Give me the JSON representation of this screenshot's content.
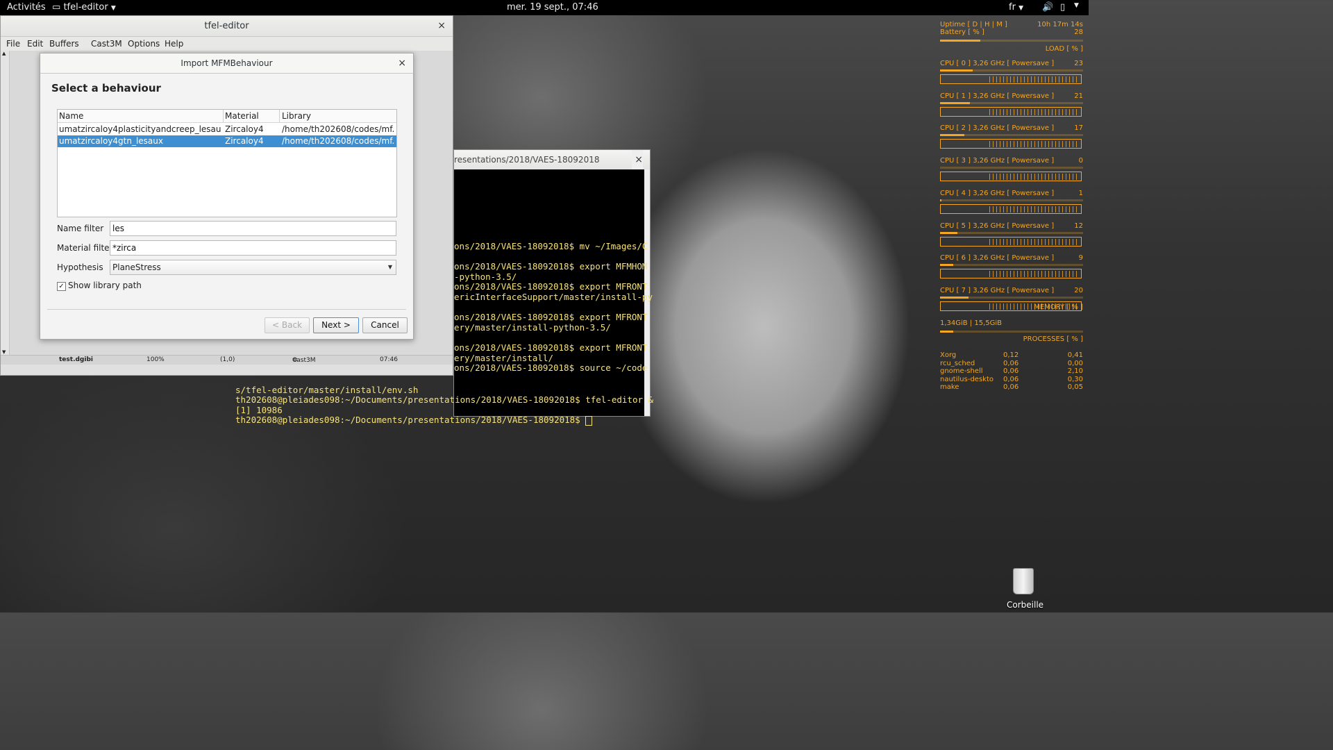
{
  "topbar": {
    "activities": "Activités",
    "app_menu": "tfel-editor",
    "clock": "mer. 19 sept., 07:46",
    "language": "fr"
  },
  "main_window": {
    "title": "tfel-editor",
    "menu": [
      "File",
      "Edit",
      "Buffers",
      "Cast3M",
      "Options",
      "Help"
    ],
    "status": {
      "file": "test.dgibi",
      "zoom": "100%",
      "position": "(1,0)",
      "mode": "Cast3M",
      "time": "07:46"
    }
  },
  "dialog": {
    "title": "Import MFMBehaviour",
    "heading": "Select a behaviour",
    "columns": [
      "Name",
      "Material",
      "Library"
    ],
    "rows": [
      {
        "name": "umatzircaloy4plasticityandcreep_lesaux",
        "material": "Zircaloy4",
        "library": "/home/th202608/codes/mf...",
        "selected": false
      },
      {
        "name": "umatzircaloy4gtn_lesaux",
        "material": "Zircaloy4",
        "library": "/home/th202608/codes/mf...",
        "selected": true
      }
    ],
    "name_filter_label": "Name filter",
    "name_filter_value": "les",
    "material_filter_label": "Material filter",
    "material_filter_value": "*zirca",
    "hypothesis_label": "Hypothesis",
    "hypothesis_value": "PlaneStress",
    "show_library_label": "Show library path",
    "show_library_checked": true,
    "buttons": {
      "back": "< Back",
      "next": "Next >",
      "cancel": "Cancel"
    }
  },
  "terminal": {
    "title": "resentations/2018/VAES-18092018",
    "lines_inner": [
      "ons/2018/VAES-18092018$ mv ~/Images/C",
      "",
      "ons/2018/VAES-18092018$ export MFMHOM",
      "-python-3.5/",
      "ons/2018/VAES-18092018$ export MFRONT",
      "ericInterfaceSupport/master/install-py",
      "",
      "ons/2018/VAES-18092018$ export MFRONT",
      "ery/master/install-python-3.5/",
      "",
      "ons/2018/VAES-18092018$ export MFRONT",
      "ery/master/install/",
      "ons/2018/VAES-18092018$ source ~/code"
    ],
    "lines_outer": [
      "s/tfel-editor/master/install/env.sh",
      "th202608@pleiades098:~/Documents/presentations/2018/VAES-18092018$ tfel-editor &",
      "[1] 10986",
      "th202608@pleiades098:~/Documents/presentations/2018/VAES-18092018$ "
    ]
  },
  "conky": {
    "uptime_label": "Uptime [ D | H | M ]",
    "uptime_value": "10h 17m 14s",
    "battery_label": "Battery [ % ]",
    "battery_value": "28",
    "battery_fraction": 0.28,
    "load_label": "LOAD [ % ]",
    "cpus": [
      {
        "label": "CPU [ 0 ] 3,26 GHz [ Powersave ]",
        "value": "23",
        "fraction": 0.23
      },
      {
        "label": "CPU [ 1 ] 3,26 GHz [ Powersave ]",
        "value": "21",
        "fraction": 0.21
      },
      {
        "label": "CPU [ 2 ] 3,26 GHz [ Powersave ]",
        "value": "17",
        "fraction": 0.17
      },
      {
        "label": "CPU [ 3 ] 3,26 GHz [ Powersave ]",
        "value": "0",
        "fraction": 0.0
      },
      {
        "label": "CPU [ 4 ] 3,26 GHz [ Powersave ]",
        "value": "1",
        "fraction": 0.01
      },
      {
        "label": "CPU [ 5 ] 3,26 GHz [ Powersave ]",
        "value": "12",
        "fraction": 0.12
      },
      {
        "label": "CPU [ 6 ] 3,26 GHz [ Powersave ]",
        "value": "9",
        "fraction": 0.09
      },
      {
        "label": "CPU [ 7 ] 3,26 GHz [ Powersave ]",
        "value": "20",
        "fraction": 0.2
      }
    ],
    "memory_label": "MEMORY [ % ]",
    "memory_value": "1,34GiB | 15,5GiB",
    "memory_fraction": 0.09,
    "processes_label": "PROCESSES [ % ]",
    "processes": [
      {
        "name": "Xorg",
        "cpu": "0,12",
        "mem": "0,41"
      },
      {
        "name": "rcu_sched",
        "cpu": "0,06",
        "mem": "0,00"
      },
      {
        "name": "gnome-shell",
        "cpu": "0,06",
        "mem": "2,10"
      },
      {
        "name": "nautilus-deskto",
        "cpu": "0,06",
        "mem": "0,30"
      },
      {
        "name": "make",
        "cpu": "0,06",
        "mem": "0,05"
      }
    ]
  },
  "desktop": {
    "trash_label": "Corbeille"
  }
}
